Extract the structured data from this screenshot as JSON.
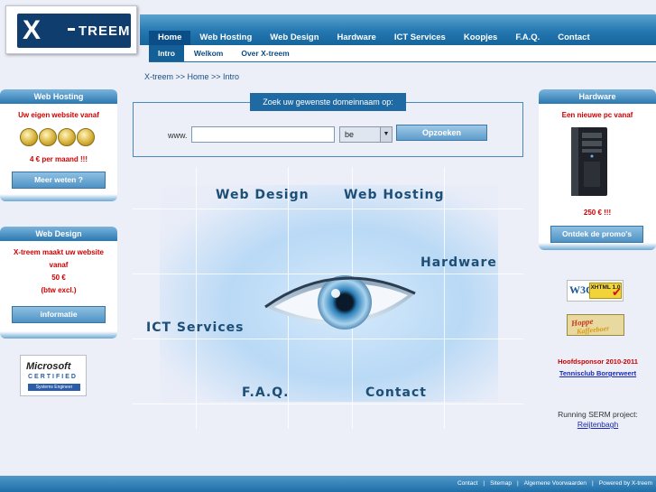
{
  "brand": {
    "logo_x": "X",
    "logo_treem": "TREEM"
  },
  "nav": {
    "items": [
      "Home",
      "Web Hosting",
      "Web Design",
      "Hardware",
      "ICT Services",
      "Koopjes",
      "F.A.Q.",
      "Contact"
    ],
    "active": "Home"
  },
  "subnav": {
    "items": [
      "Intro",
      "Welkom",
      "Over X-treem"
    ],
    "active": "Intro"
  },
  "breadcrumb": "X-treem >> Home >> Intro",
  "search": {
    "title": "Zoek uw gewenste domeinnaam op:",
    "prefix": "www.",
    "input_value": "",
    "tld_selected": "be",
    "button": "Opzoeken"
  },
  "hero": {
    "links": [
      "Web Design",
      "Web Hosting",
      "Hardware",
      "ICT Services",
      "F.A.Q.",
      "Contact"
    ]
  },
  "left": {
    "hosting": {
      "title": "Web Hosting",
      "line1": "Uw eigen website vanaf",
      "price": "4 € per maand !!!",
      "button": "Meer weten ?"
    },
    "design": {
      "title": "Web Design",
      "line1": "X-treem maakt uw website",
      "line2": "vanaf",
      "price": "50 €",
      "vat": "(btw excl.)",
      "button": "informatie"
    },
    "ms_badge": {
      "brand": "Microsoft",
      "certified": "CERTIFIED",
      "role": "Systems Engineer"
    }
  },
  "right": {
    "hardware": {
      "title": "Hardware",
      "line1": "Een nieuwe pc vanaf",
      "price": "250 € !!!",
      "button": "Ontdek de promo's"
    },
    "w3c": {
      "a": "W3C",
      "b": "XHTML 1.0"
    },
    "sponsor_badge": {
      "t1": "Hoppe",
      "t2": "Kaffeeboer"
    },
    "sponsor": {
      "label": "Hoofdsponsor 2010-2011",
      "link": "Tennisclub Borgerweert"
    },
    "serm": {
      "label": "Running SERM project:",
      "link": "Reijtenbagh"
    }
  },
  "footer": {
    "links": [
      "Contact",
      "Sitemap",
      "Algemene Voorwaarden",
      "Powered by X-treem"
    ]
  },
  "colors": {
    "accent": "#2477b0",
    "nav_active": "#0b4d86",
    "promo_red": "#cc0000"
  }
}
